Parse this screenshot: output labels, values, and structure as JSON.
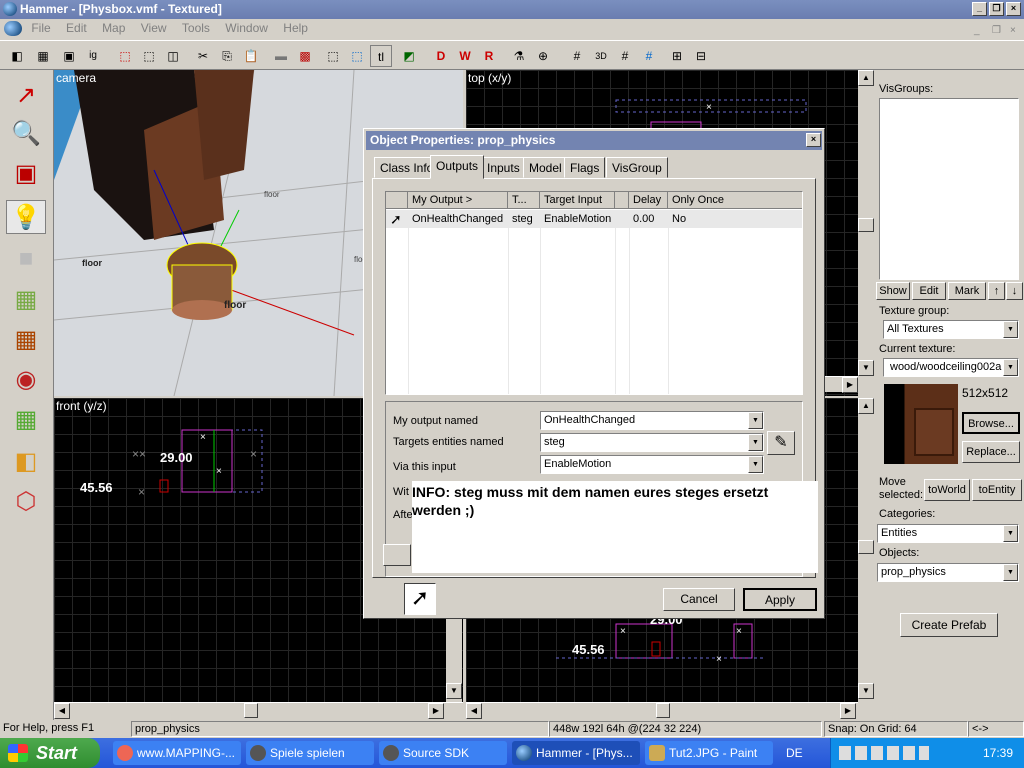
{
  "window": {
    "title": "Hammer - [Physbox.vmf - Textured]"
  },
  "menu": [
    "File",
    "Edit",
    "Map",
    "View",
    "Tools",
    "Window",
    "Help"
  ],
  "viewports": {
    "camera": {
      "label": "camera",
      "texts": [
        "floor",
        "floor",
        "floor",
        "floor"
      ]
    },
    "top": {
      "label": "top (x/y)",
      "dims": [
        "29.00",
        "45.56"
      ]
    },
    "front": {
      "label": "front (y/z)",
      "dims": [
        "29.00",
        "45.56"
      ]
    }
  },
  "visgroups": {
    "label": "VisGroups:",
    "buttons": [
      "Show",
      "Edit",
      "Mark",
      "↑",
      "↓"
    ]
  },
  "texture": {
    "group_label": "Texture group:",
    "group_value": "All Textures",
    "current_label": "Current texture:",
    "current_value": "wood/woodceiling002a",
    "size": "512x512",
    "browse": "Browse...",
    "replace": "Replace..."
  },
  "move": {
    "label": "Move selected:",
    "to_world": "toWorld",
    "to_entity": "toEntity"
  },
  "categories": {
    "label": "Categories:",
    "value": "Entities"
  },
  "objects": {
    "label": "Objects:",
    "value": "prop_physics"
  },
  "create_prefab": "Create Prefab",
  "dialog": {
    "title": "Object Properties: prop_physics",
    "tabs": [
      "Class Info",
      "Outputs",
      "Inputs",
      "Model",
      "Flags",
      "VisGroup"
    ],
    "active_tab": "Outputs",
    "columns": [
      "My Output  >",
      "T...",
      "Target Input",
      "Delay",
      "Only Once"
    ],
    "rows": [
      {
        "output": "OnHealthChanged",
        "target": "steg",
        "input": "EnableMotion",
        "delay": "0.00",
        "once": "No"
      }
    ],
    "fields": {
      "output_label": "My output named",
      "output_value": "OnHealthChanged",
      "targets_label": "Targets entities named",
      "targets_value": "steg",
      "via_label": "Via this input",
      "via_value": "EnableMotion",
      "with_label": "Wit",
      "after_label": "Afte"
    },
    "info": "INFO: steg muss mit dem namen eures  steges ersetzt werden ;)",
    "cancel": "Cancel",
    "apply": "Apply"
  },
  "status": {
    "help": "For Help, press F1",
    "object": "prop_physics",
    "coords": "448w 192l 64h @(224 32 224)",
    "snap": "Snap: On Grid: 64",
    "arrows": "<->"
  },
  "taskbar": {
    "start": "Start",
    "tasks": [
      "www.MAPPING-...",
      "Spiele spielen",
      "Source SDK",
      "Hammer - [Phys...",
      "Tut2.JPG - Paint"
    ],
    "lang": "DE",
    "time": "17:39"
  }
}
